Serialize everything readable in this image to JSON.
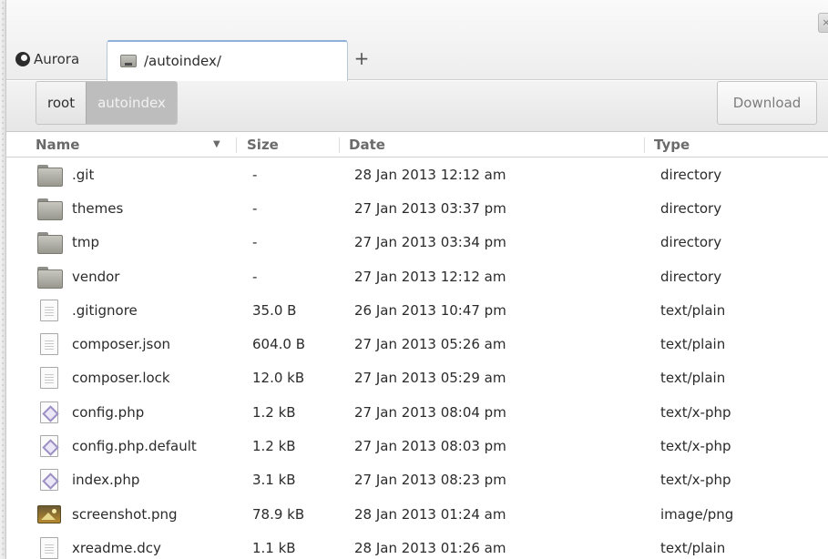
{
  "window": {
    "close_label": "×"
  },
  "brand": {
    "name": "Aurora"
  },
  "tabs": [
    {
      "label": "/autoindex/",
      "icon": "folder-icon"
    }
  ],
  "new_tab_label": "+",
  "breadcrumb": {
    "root": "root",
    "current": "autoindex"
  },
  "toolbar": {
    "download_label": "Download"
  },
  "table": {
    "headers": {
      "name": "Name",
      "sort_indicator": "▼",
      "size": "Size",
      "date": "Date",
      "type": "Type"
    },
    "rows": [
      {
        "name": ".git",
        "size": "-",
        "date": "28 Jan 2013 12:12 am",
        "type": "directory",
        "icon": "folder-icon"
      },
      {
        "name": "themes",
        "size": "-",
        "date": "27 Jan 2013 03:37 pm",
        "type": "directory",
        "icon": "folder-icon"
      },
      {
        "name": "tmp",
        "size": "-",
        "date": "27 Jan 2013 03:34 pm",
        "type": "directory",
        "icon": "folder-icon"
      },
      {
        "name": "vendor",
        "size": "-",
        "date": "27 Jan 2013 12:12 am",
        "type": "directory",
        "icon": "folder-icon"
      },
      {
        "name": ".gitignore",
        "size": "35.0 B",
        "date": "26 Jan 2013 10:47 pm",
        "type": "text/plain",
        "icon": "text-file-icon"
      },
      {
        "name": "composer.json",
        "size": "604.0 B",
        "date": "27 Jan 2013 05:26 am",
        "type": "text/plain",
        "icon": "text-file-icon"
      },
      {
        "name": "composer.lock",
        "size": "12.0 kB",
        "date": "27 Jan 2013 05:29 am",
        "type": "text/plain",
        "icon": "text-file-icon"
      },
      {
        "name": "config.php",
        "size": "1.2 kB",
        "date": "27 Jan 2013 08:04 pm",
        "type": "text/x-php",
        "icon": "php-file-icon"
      },
      {
        "name": "config.php.default",
        "size": "1.2 kB",
        "date": "27 Jan 2013 08:03 pm",
        "type": "text/x-php",
        "icon": "php-file-icon"
      },
      {
        "name": "index.php",
        "size": "3.1 kB",
        "date": "27 Jan 2013 08:23 pm",
        "type": "text/x-php",
        "icon": "php-file-icon"
      },
      {
        "name": "screenshot.png",
        "size": "78.9 kB",
        "date": "28 Jan 2013 01:24 am",
        "type": "image/png",
        "icon": "image-file-icon"
      },
      {
        "name": "xreadme.dcy",
        "size": "1.1 kB",
        "date": "28 Jan 2013 01:26 am",
        "type": "text/plain",
        "icon": "text-file-icon"
      }
    ]
  }
}
